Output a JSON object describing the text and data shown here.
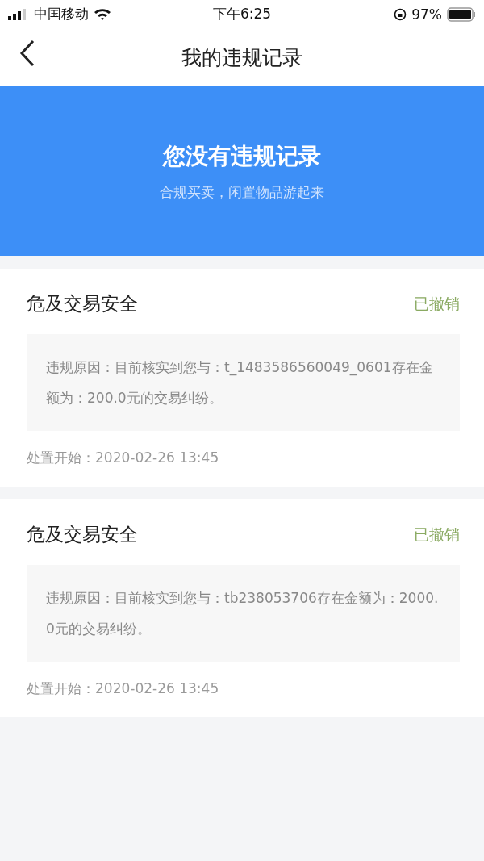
{
  "status_bar": {
    "carrier": "中国移动",
    "time": "下午6:25",
    "battery": "97%"
  },
  "nav": {
    "title": "我的违规记录"
  },
  "banner": {
    "title": "您没有违规记录",
    "subtitle": "合规买卖，闲置物品游起来"
  },
  "records": [
    {
      "title": "危及交易安全",
      "status": "已撤销",
      "reason": "违规原因：目前核实到您与：t_1483586560049_0601存在金额为：200.0元的交易纠纷。",
      "start": "处置开始：2020-02-26 13:45"
    },
    {
      "title": "危及交易安全",
      "status": "已撤销",
      "reason": "违规原因：目前核实到您与：tb238053706存在金额为：2000.0元的交易纠纷。",
      "start": "处置开始：2020-02-26 13:45"
    }
  ]
}
